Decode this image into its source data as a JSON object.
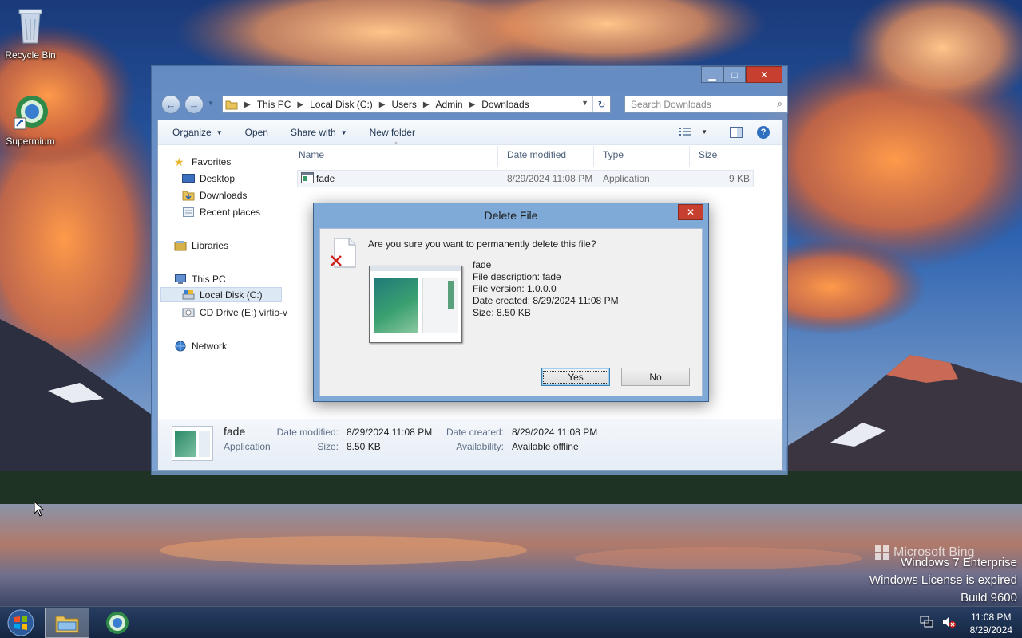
{
  "desktop": {
    "icons": [
      {
        "label": "Recycle Bin",
        "icon": "recycle-bin-icon"
      },
      {
        "label": "Supermium",
        "icon": "supermium-icon"
      }
    ],
    "watermark": {
      "brand": "Microsoft Bing",
      "line1": "Windows 7 Enterprise",
      "line2": "Windows License is expired",
      "line3": "Build 9600"
    }
  },
  "explorer": {
    "caption_buttons": {
      "minimize": "▁",
      "maximize": "□",
      "close": "✕"
    },
    "breadcrumb": [
      "This PC",
      "Local Disk (C:)",
      "Users",
      "Admin",
      "Downloads"
    ],
    "search_placeholder": "Search Downloads",
    "toolbar": {
      "organize": "Organize",
      "open": "Open",
      "share_with": "Share with",
      "new_folder": "New folder"
    },
    "nav": {
      "favorites": "Favorites",
      "desktop": "Desktop",
      "downloads": "Downloads",
      "recent_places": "Recent places",
      "libraries": "Libraries",
      "this_pc": "This PC",
      "local_disk": "Local Disk (C:)",
      "cd_drive": "CD Drive (E:) virtio-v",
      "network": "Network"
    },
    "columns": {
      "name": "Name",
      "date_modified": "Date modified",
      "type": "Type",
      "size": "Size"
    },
    "files": [
      {
        "name": "fade",
        "date_modified": "8/29/2024 11:08 PM",
        "type": "Application",
        "size": "9 KB"
      }
    ],
    "details": {
      "name": "fade",
      "type": "Application",
      "date_modified_label": "Date modified:",
      "date_modified": "8/29/2024 11:08 PM",
      "size_label": "Size:",
      "size": "8.50 KB",
      "date_created_label": "Date created:",
      "date_created": "8/29/2024 11:08 PM",
      "availability_label": "Availability:",
      "availability": "Available offline"
    }
  },
  "dialog": {
    "title": "Delete File",
    "close": "✕",
    "question": "Are you sure you want to permanently delete this file?",
    "file_name": "fade",
    "description": "File description: fade",
    "version": "File version: 1.0.0.0",
    "date_created": "Date created: 8/29/2024 11:08 PM",
    "size": "Size: 8.50 KB",
    "yes": "Yes",
    "no": "No"
  },
  "taskbar": {
    "clock_time": "11:08 PM",
    "clock_date": "8/29/2024"
  }
}
